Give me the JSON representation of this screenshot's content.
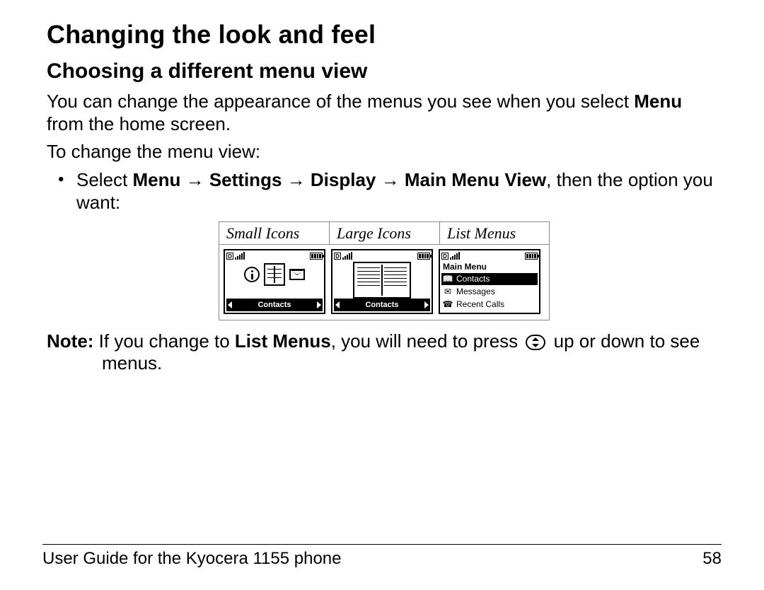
{
  "heading": "Changing the look and feel",
  "subheading": "Choosing a different menu view",
  "intro": {
    "line1a": "You can change the appearance of the menus you see when you select",
    "bold_menu": "Menu",
    "line1b": " from the home screen.",
    "line2": "To change the menu view:"
  },
  "step": {
    "prefix": "Select ",
    "b1": "Menu",
    "arrow": " → ",
    "b2": "Settings",
    "b3": "Display",
    "b4": "Main Menu View",
    "suffix": ", then the option you want:"
  },
  "menuview": {
    "tabs": [
      "Small Icons",
      "Large Icons",
      "List Menus"
    ],
    "status_d": "D",
    "softkey": "Contacts",
    "list": {
      "title": "Main Menu",
      "items": [
        "Contacts",
        "Messages",
        "Recent Calls"
      ]
    }
  },
  "note": {
    "label": "Note:",
    "t1": " If you change to ",
    "b1": "List Menus",
    "t2": ", you will need to press ",
    "t3": " up or down to see menus."
  },
  "footer": {
    "left": "User Guide for the Kyocera 1155 phone",
    "right": "58"
  }
}
